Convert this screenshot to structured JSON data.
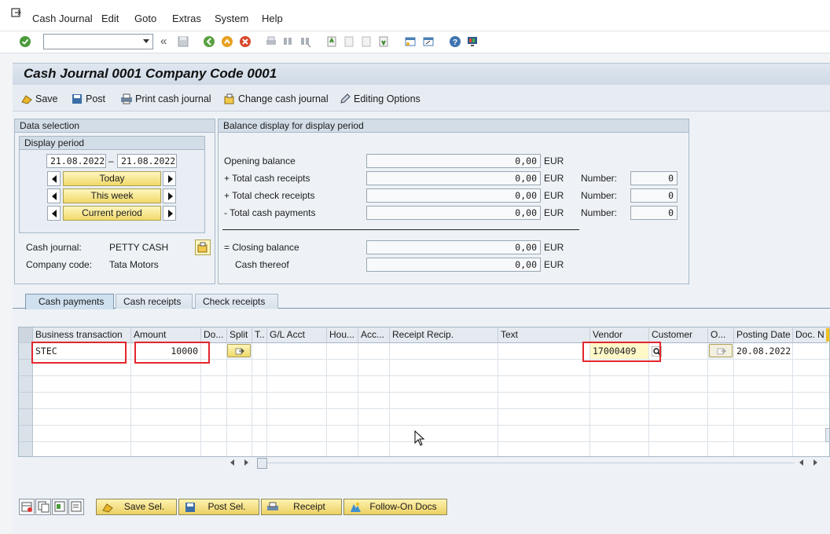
{
  "menu": [
    "Cash Journal",
    "Edit",
    "Goto",
    "Extras",
    "System",
    "Help"
  ],
  "title": "Cash Journal 0001 Company Code 0001",
  "app_toolbar": {
    "save": "Save",
    "post": "Post",
    "print": "Print cash journal",
    "change": "Change cash journal",
    "editing": "Editing Options"
  },
  "data_selection": {
    "header": "Data selection",
    "period_header": "Display period",
    "date_from": "21.08.2022",
    "dash": "–",
    "date_to": "21.08.2022",
    "today": "Today",
    "this_week": "This week",
    "current_period": "Current period",
    "cash_journal_label": "Cash journal:",
    "cash_journal_value": "PETTY CASH",
    "company_code_label": "Company code:",
    "company_code_value": "Tata Motors"
  },
  "balance": {
    "header": "Balance display for display period",
    "rows": [
      {
        "label": "Opening balance",
        "value": "0,00",
        "currency": "EUR"
      },
      {
        "label": "+ Total cash receipts",
        "value": "0,00",
        "currency": "EUR",
        "number_label": "Number:",
        "number": "0"
      },
      {
        "label": "+ Total check receipts",
        "value": "0,00",
        "currency": "EUR",
        "number_label": "Number:",
        "number": "0"
      },
      {
        "label": "- Total cash payments",
        "value": "0,00",
        "currency": "EUR",
        "number_label": "Number:",
        "number": "0"
      },
      {
        "label": "= Closing balance",
        "value": "0,00",
        "currency": "EUR"
      },
      {
        "label": "Cash thereof",
        "value": "0,00",
        "currency": "EUR"
      }
    ]
  },
  "tabs": [
    "Cash payments",
    "Cash receipts",
    "Check receipts"
  ],
  "table": {
    "headers": [
      "Business transaction",
      "Amount",
      "Do...",
      "Split",
      "T..",
      "G/L Acct",
      "Hou...",
      "Acc...",
      "Receipt Recip.",
      "Text",
      "Vendor",
      "Customer",
      "O...",
      "Posting Date",
      "Doc. N"
    ],
    "row": {
      "business_transaction": "STEC",
      "amount": "10000",
      "vendor": "17000409",
      "posting_date": "20.08.2022"
    }
  },
  "bottom_buttons": {
    "save_sel": "Save Sel.",
    "post_sel": "Post Sel.",
    "receipt": "Receipt",
    "follow_on": "Follow-On Docs"
  },
  "colors": {
    "highlight": "#e3262e",
    "yellow_button": "#f0d96a"
  }
}
